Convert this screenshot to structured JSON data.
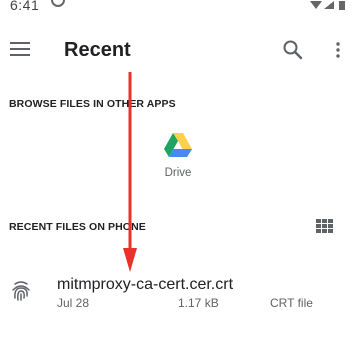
{
  "status_bar": {
    "time": "6:41"
  },
  "app_bar": {
    "title": "Recent",
    "menu_icon": "hamburger-menu-icon",
    "search_icon": "search-icon",
    "more_icon": "more-vert-icon"
  },
  "browse_section": {
    "heading": "BROWSE FILES IN OTHER APPS",
    "apps": [
      {
        "label": "Drive",
        "icon": "google-drive-icon"
      }
    ]
  },
  "recent_section": {
    "heading": "RECENT FILES ON PHONE",
    "view_toggle_icon": "grid-view-icon",
    "files": [
      {
        "name": "mitmproxy-ca-cert.cer.crt",
        "date": "Jul 28",
        "size": "1.17 kB",
        "type": "CRT file",
        "icon": "fingerprint-icon"
      }
    ]
  },
  "colors": {
    "arrow": "#e8322b",
    "drive_green": "#1fa463",
    "drive_yellow": "#ffd04b",
    "drive_blue": "#4688f4"
  }
}
